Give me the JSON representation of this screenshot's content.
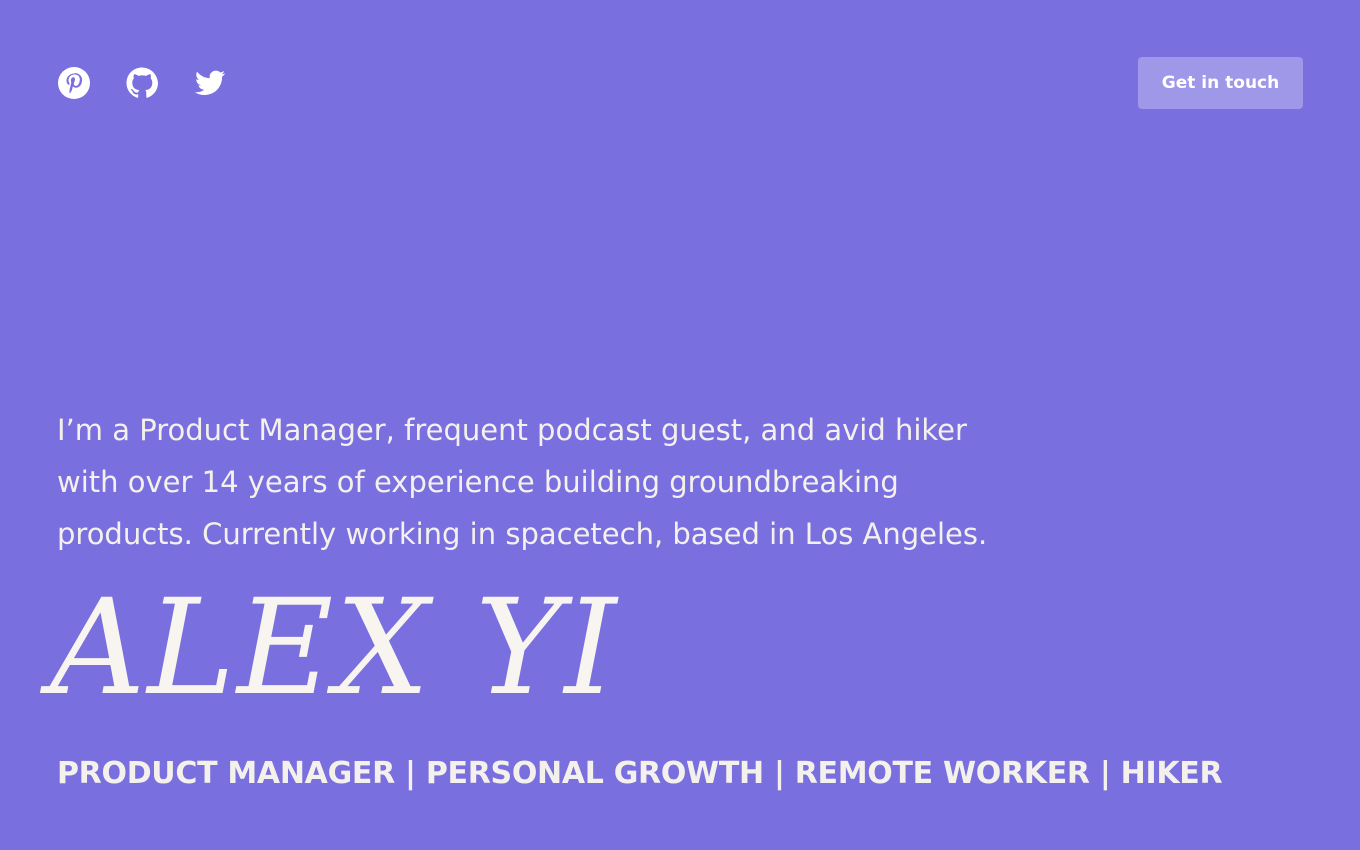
{
  "header": {
    "social_links": [
      {
        "icon": "pinterest-icon",
        "label": "Pinterest"
      },
      {
        "icon": "github-icon",
        "label": "GitHub"
      },
      {
        "icon": "twitter-icon",
        "label": "Twitter"
      }
    ],
    "cta_label": "Get in touch"
  },
  "hero": {
    "intro_lines": [
      "I’m a Product Manager, frequent podcast guest, and avid hiker",
      "with over 14 years of experience building groundbreaking",
      "products. Currently working in spacetech, based in Los Angeles."
    ],
    "name": "ALEX YI",
    "tagline": "PRODUCT MANAGER | PERSONAL GROWTH | REMOTE WORKER | HIKER"
  },
  "colors": {
    "background": "#7a6fde",
    "text": "#f7f4ef",
    "button_bg": "rgba(255,255,255,0.28)"
  }
}
